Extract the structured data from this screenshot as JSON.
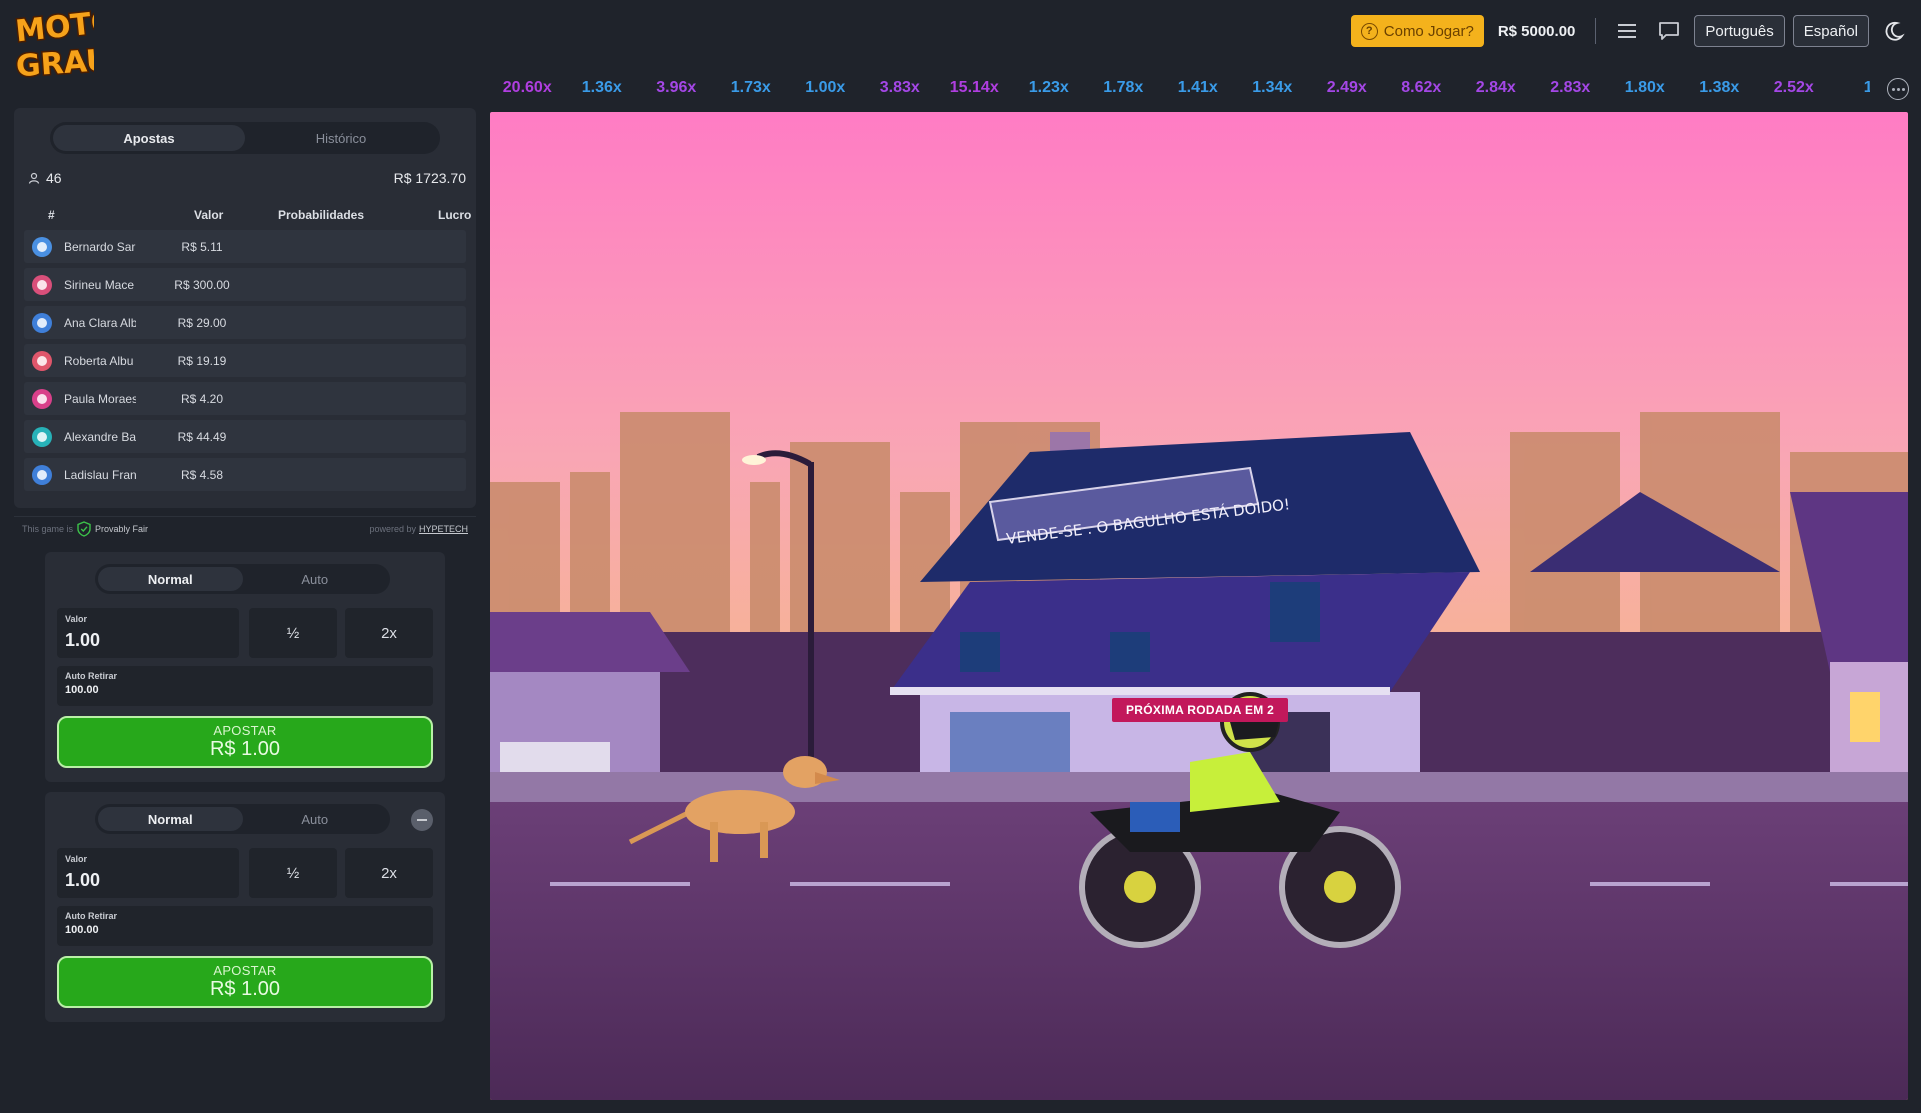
{
  "header": {
    "logo_text": [
      "MOTO",
      "GRAU"
    ],
    "how_to_play": "Como Jogar?",
    "balance": "R$ 5000.00",
    "languages": [
      "Português",
      "Español"
    ]
  },
  "multipliers": [
    {
      "v": "20.60x",
      "c": "#b03ee0"
    },
    {
      "v": "1.36x",
      "c": "#3a9be8"
    },
    {
      "v": "3.96x",
      "c": "#a447e6"
    },
    {
      "v": "1.73x",
      "c": "#3a9be8"
    },
    {
      "v": "1.00x",
      "c": "#3a9be8"
    },
    {
      "v": "3.83x",
      "c": "#a447e6"
    },
    {
      "v": "15.14x",
      "c": "#b03ee0"
    },
    {
      "v": "1.23x",
      "c": "#3a9be8"
    },
    {
      "v": "1.78x",
      "c": "#3a9be8"
    },
    {
      "v": "1.41x",
      "c": "#3a9be8"
    },
    {
      "v": "1.34x",
      "c": "#3a9be8"
    },
    {
      "v": "2.49x",
      "c": "#a447e6"
    },
    {
      "v": "8.62x",
      "c": "#a447e6"
    },
    {
      "v": "2.84x",
      "c": "#a447e6"
    },
    {
      "v": "2.83x",
      "c": "#a447e6"
    },
    {
      "v": "1.80x",
      "c": "#3a9be8"
    },
    {
      "v": "1.38x",
      "c": "#3a9be8"
    },
    {
      "v": "2.52x",
      "c": "#a447e6"
    },
    {
      "v": "1",
      "c": "#3a9be8"
    }
  ],
  "bets": {
    "tabs": [
      "Apostas",
      "Histórico"
    ],
    "player_count": "46",
    "total": "R$ 1723.70",
    "columns": [
      "#",
      "Valor",
      "Probabilidades",
      "Lucro"
    ],
    "rows": [
      {
        "name": "Bernardo Sar",
        "value": "R$ 5.11",
        "color": "#4a90e2"
      },
      {
        "name": "Sirineu Mace",
        "value": "R$ 300.00",
        "color": "#d94f7a"
      },
      {
        "name": "Ana Clara Alb",
        "value": "R$ 29.00",
        "color": "#3f7fd9"
      },
      {
        "name": "Roberta Albu",
        "value": "R$ 19.19",
        "color": "#e0566b"
      },
      {
        "name": "Paula Moraes",
        "value": "R$ 4.20",
        "color": "#d9408a"
      },
      {
        "name": "Alexandre Ba",
        "value": "R$ 44.49",
        "color": "#27b2b8"
      },
      {
        "name": "Ladislau Fran",
        "value": "R$ 4.58",
        "color": "#3f7fd9"
      }
    ]
  },
  "provably": {
    "prefix": "This game is",
    "label": "Provably Fair",
    "powered": "powered by",
    "brand": "HYPETECH"
  },
  "bet_panels": [
    {
      "modes": [
        "Normal",
        "Auto"
      ],
      "value_label": "Valor",
      "value": "1.00",
      "half": "½",
      "double": "2x",
      "auto_label": "Auto Retirar",
      "auto_value": "100.00",
      "button_label": "APOSTAR",
      "button_amount": "R$ 1.00"
    },
    {
      "modes": [
        "Normal",
        "Auto"
      ],
      "value_label": "Valor",
      "value": "1.00",
      "half": "½",
      "double": "2x",
      "auto_label": "Auto Retirar",
      "auto_value": "100.00",
      "button_label": "APOSTAR",
      "button_amount": "R$ 1.00"
    }
  ],
  "game": {
    "sign_text": "VENDE-SE . O BAGULHO ESTÁ DOIDO!",
    "next_round": "PRÓXIMA RODADA EM 2"
  },
  "icons": {
    "help": "question-circle-icon",
    "menu": "hamburger-menu-icon",
    "chat": "chat-bubble-icon",
    "theme": "moon-icon",
    "players": "user-icon",
    "shield": "shield-check-icon",
    "more": "more-dots-icon",
    "remove": "minus-circle-icon"
  }
}
